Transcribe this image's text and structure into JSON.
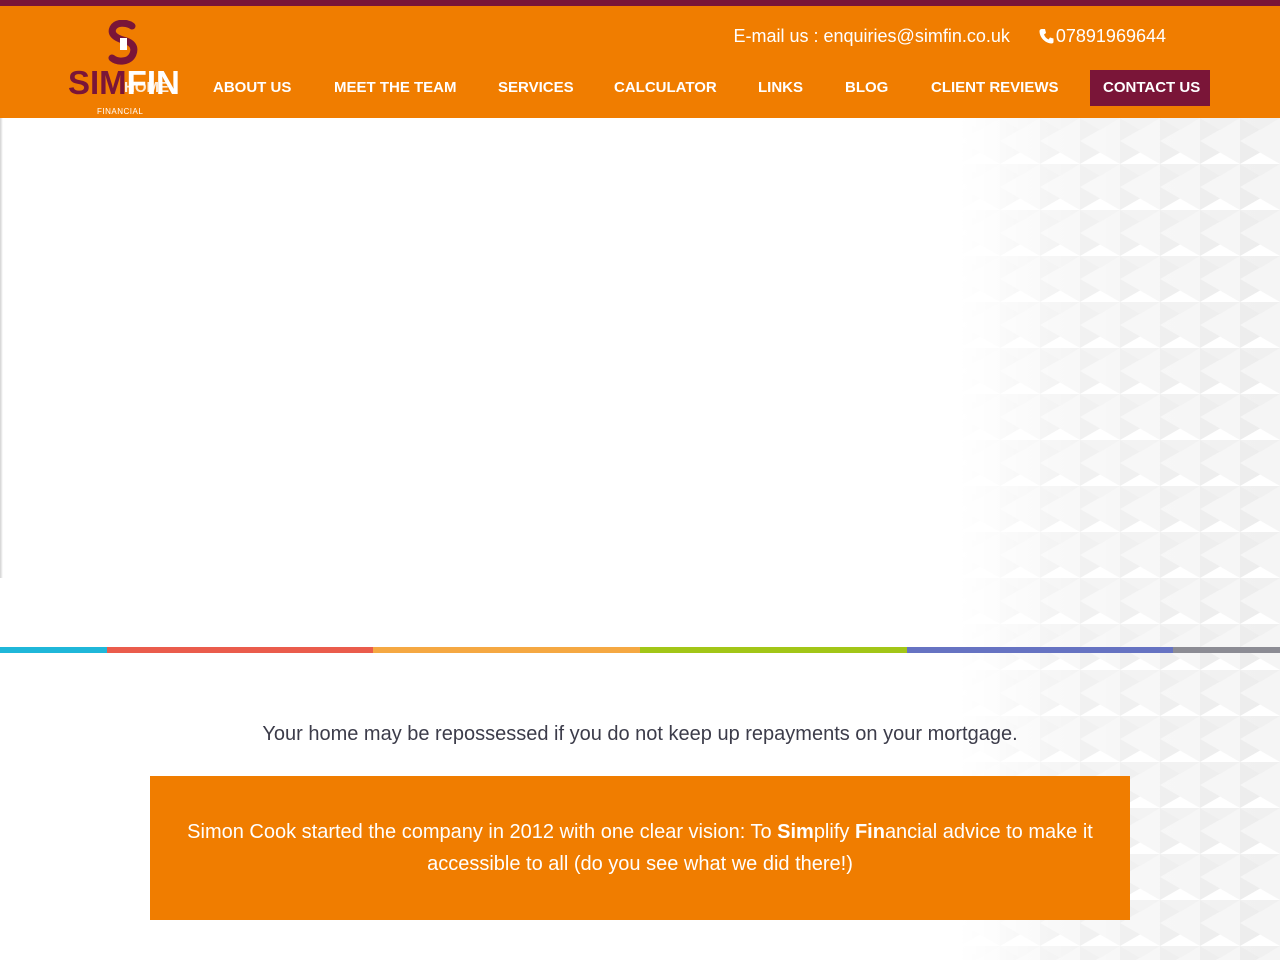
{
  "brand": {
    "logo_sim": "SIM",
    "logo_fin": "FIN",
    "logo_sub": "FINANCIAL",
    "colors": {
      "orange": "#f07d00",
      "maroon": "#7a1538"
    }
  },
  "contact": {
    "email_text": "E-mail us : enquiries@simfin.co.uk",
    "phone": "07891969644",
    "phone_icon": "phone-icon"
  },
  "nav": {
    "items": [
      {
        "label": "HOME"
      },
      {
        "label": "ABOUT US"
      },
      {
        "label": "MEET THE TEAM"
      },
      {
        "label": "SERVICES"
      },
      {
        "label": "CALCULATOR"
      },
      {
        "label": "LINKS"
      },
      {
        "label": "BLOG"
      },
      {
        "label": "CLIENT REVIEWS"
      }
    ],
    "cta": "CONTACT US"
  },
  "color_bar": [
    "#1fb7d9",
    "#ea5c4c",
    "#f5a842",
    "#a2c617",
    "#6673c2",
    "#8c8c94"
  ],
  "disclaimer": "Your home may be repossessed if you do not keep up repayments on your mortgage.",
  "vision": {
    "part1": "Simon Cook started the company in 2012 with one clear vision: To ",
    "sim": "Sim",
    "plify": "plify ",
    "fin": "Fin",
    "rest": "ancial advice to make it accessible to all (do you see what we did there!)"
  }
}
